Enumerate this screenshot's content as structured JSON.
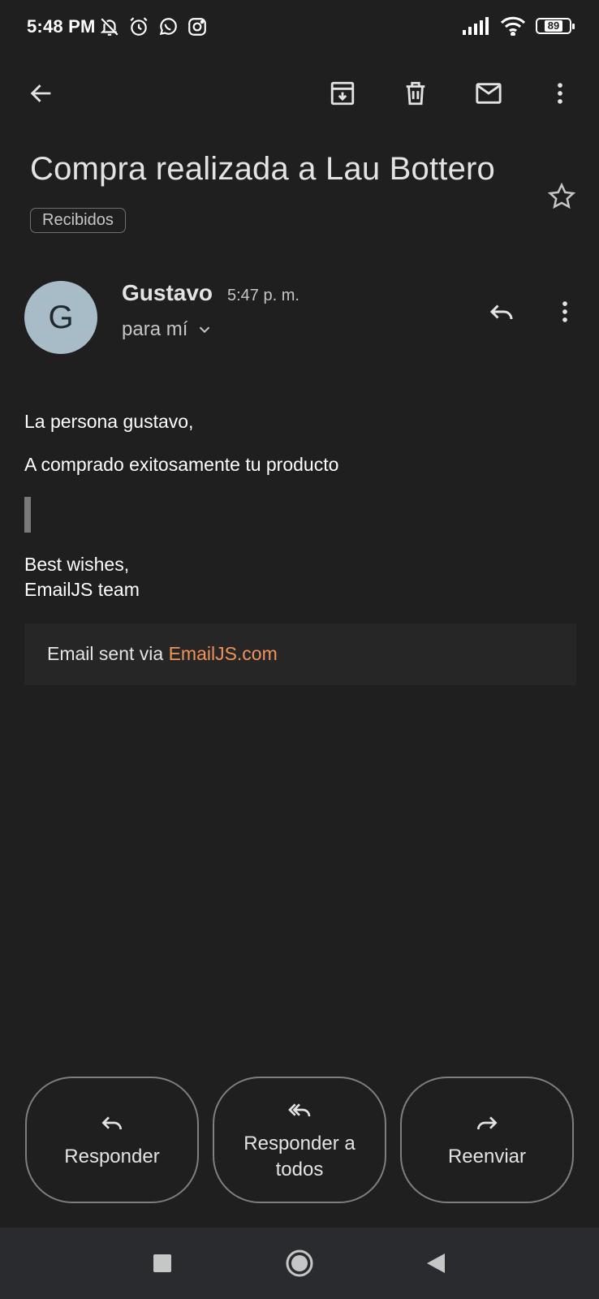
{
  "status_bar": {
    "time": "5:48 PM",
    "left_icons": [
      "bell-off-icon",
      "alarm-icon",
      "whatsapp-icon",
      "instagram-icon"
    ],
    "right_icons": [
      "signal-icon",
      "wifi-icon",
      "battery-icon"
    ],
    "battery_level": "89"
  },
  "app_bar": {
    "actions": [
      "back-arrow-icon",
      "archive-icon",
      "delete-icon",
      "mark-unread-icon",
      "more-vert-icon"
    ]
  },
  "email": {
    "subject": "Compra realizada a Lau Bottero",
    "label": "Recibidos",
    "sender": {
      "initial": "G",
      "name": "Gustavo",
      "time": "5:47 p. m.",
      "recipients": "para mí"
    },
    "body": {
      "greeting": "La persona gustavo,",
      "line1": "A comprado exitosamente tu producto",
      "signoff1": "Best wishes,",
      "signoff2": "EmailJS team"
    },
    "footer": {
      "prefix": "Email sent via ",
      "link": "EmailJS.com"
    }
  },
  "actions": {
    "reply": "Responder",
    "reply_all": "Responder a todos",
    "forward": "Reenviar"
  },
  "colors": {
    "background": "#1f1f1f",
    "avatar": "#a7bcc7",
    "link": "#f0935a",
    "nav_bar": "#2a2b2f"
  }
}
